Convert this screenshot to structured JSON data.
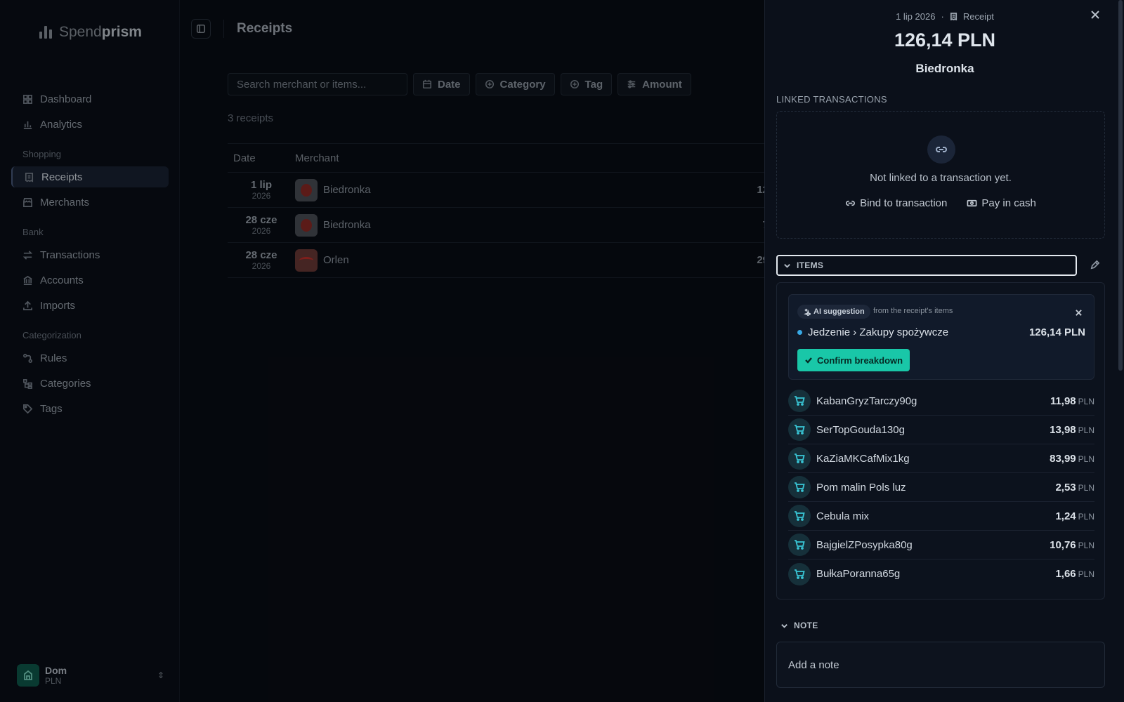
{
  "app": {
    "brand_light": "Spend",
    "brand_bold": "prism",
    "page_title": "Receipts"
  },
  "sidebar": {
    "main": [
      {
        "label": "Dashboard",
        "icon": "grid-icon"
      },
      {
        "label": "Analytics",
        "icon": "bar-chart-icon"
      }
    ],
    "sections": [
      {
        "title": "Shopping",
        "items": [
          {
            "label": "Receipts",
            "icon": "receipt-icon",
            "active": true
          },
          {
            "label": "Merchants",
            "icon": "store-icon"
          }
        ]
      },
      {
        "title": "Bank",
        "items": [
          {
            "label": "Transactions",
            "icon": "arrows-icon"
          },
          {
            "label": "Accounts",
            "icon": "bank-icon"
          },
          {
            "label": "Imports",
            "icon": "upload-icon"
          }
        ]
      },
      {
        "title": "Categorization",
        "items": [
          {
            "label": "Rules",
            "icon": "rules-icon"
          },
          {
            "label": "Categories",
            "icon": "tree-icon"
          },
          {
            "label": "Tags",
            "icon": "tag-icon"
          }
        ]
      }
    ],
    "workspace": {
      "name": "Dom",
      "currency": "PLN"
    }
  },
  "filters": {
    "search_placeholder": "Search merchant or items...",
    "date": "Date",
    "category": "Category",
    "tag": "Tag",
    "amount": "Amount"
  },
  "list": {
    "count": "3 receipts",
    "col_date": "Date",
    "col_merchant": "Merchant",
    "rows": [
      {
        "day": "1 lip",
        "year": "2026",
        "merchant": "Biedronka",
        "amount_partial": "12"
      },
      {
        "day": "28 cze",
        "year": "2026",
        "merchant": "Biedronka",
        "amount_partial": "7"
      },
      {
        "day": "28 cze",
        "year": "2026",
        "merchant": "Orlen",
        "amount_partial": "29"
      }
    ]
  },
  "panel": {
    "date": "1 lip 2026",
    "dot": "·",
    "kind": "Receipt",
    "amount": "126,14 PLN",
    "merchant": "Biedronka",
    "linked_label": "LINKED TRANSACTIONS",
    "not_linked": "Not linked to a transaction yet.",
    "bind_label": "Bind to transaction",
    "cash_label": "Pay in cash",
    "items_label": "ITEMS",
    "ai": {
      "badge": "AI suggestion",
      "from": "from the receipt's items",
      "category": "Jedzenie › Zakupy spożywcze",
      "amount": "126,14 PLN",
      "dot_color": "#38a9e6",
      "confirm": "Confirm breakdown"
    },
    "items": [
      {
        "name": "KabanGryzTarczy90g",
        "amount": "11,98",
        "currency": "PLN"
      },
      {
        "name": "SerTopGouda130g",
        "amount": "13,98",
        "currency": "PLN"
      },
      {
        "name": "KaZiaMKCafMix1kg",
        "amount": "83,99",
        "currency": "PLN"
      },
      {
        "name": "Pom malin Pols luz",
        "amount": "2,53",
        "currency": "PLN"
      },
      {
        "name": "Cebula mix",
        "amount": "1,24",
        "currency": "PLN"
      },
      {
        "name": "BajgielZPosypka80g",
        "amount": "10,76",
        "currency": "PLN"
      },
      {
        "name": "BułkaPoranna65g",
        "amount": "1,66",
        "currency": "PLN"
      }
    ],
    "note_label": "NOTE",
    "note_placeholder": "Add a note"
  },
  "colors": {
    "accent": "#19c7a8",
    "item_icon": "#39c6d6"
  }
}
